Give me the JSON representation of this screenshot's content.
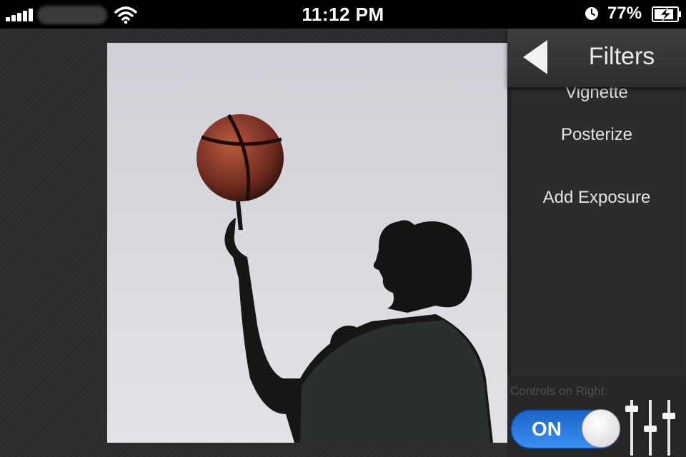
{
  "status_bar": {
    "time": "11:12 PM",
    "battery_percent": "77%",
    "icons": [
      "signal-bars-icon",
      "wifi-icon",
      "alarm-clock-icon",
      "battery-charging-icon"
    ],
    "signal_bars": 5
  },
  "sidebar": {
    "title": "Filters",
    "back_icon": "back-triangle-icon",
    "filters": [
      {
        "label": "Vignette"
      },
      {
        "label": "Posterize"
      },
      {
        "label": "Add Exposure"
      }
    ],
    "controls": {
      "label": "Controls on Right:",
      "toggle_label": "ON",
      "toggle_state": true,
      "icon": "sliders-icon"
    }
  },
  "colors": {
    "accent_blue": "#2f7fe6",
    "background": "#2a2a2b",
    "sidebar": "#2c2c2e"
  }
}
